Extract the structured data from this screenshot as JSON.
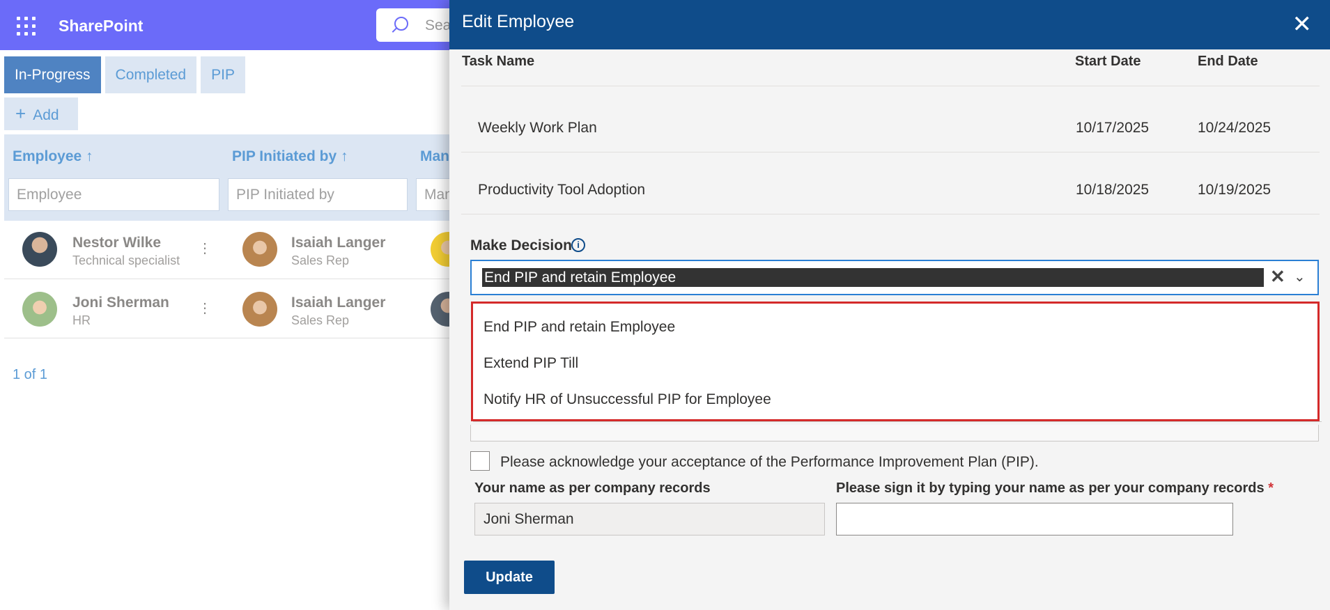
{
  "app": {
    "brand": "SharePoint",
    "search_placeholder": "Sea"
  },
  "tabs": [
    "In-Progress",
    "Completed",
    "PIP"
  ],
  "add_label": "Add",
  "grid": {
    "headers": [
      "Employee ↑",
      "PIP Initiated by ↑",
      "Man"
    ],
    "filters": [
      "Employee",
      "PIP Initiated by",
      "Man"
    ],
    "rows": [
      {
        "employee": "Nestor Wilke",
        "employee_role": "Technical specialist",
        "initiator": "Isaiah Langer",
        "initiator_role": "Sales Rep"
      },
      {
        "employee": "Joni Sherman",
        "employee_role": "HR",
        "initiator": "Isaiah Langer",
        "initiator_role": "Sales Rep"
      }
    ],
    "pager": "1 of 1"
  },
  "panel": {
    "title": "Edit Employee",
    "close_icon": "close-icon",
    "task_headers": [
      "Task Name",
      "Start Date",
      "End Date"
    ],
    "tasks": [
      {
        "name": "Weekly Work Plan",
        "start": "10/17/2025",
        "end": "10/24/2025"
      },
      {
        "name": "Productivity Tool Adoption",
        "start": "10/18/2025",
        "end": "10/19/2025"
      }
    ],
    "decision_label": "Make Decision",
    "decision_value": "End PIP and retain Employee",
    "decision_options": [
      "End PIP and retain Employee",
      "Extend PIP Till",
      "Notify HR of Unsuccessful PIP for Employee"
    ],
    "ack_label": "Please acknowledge your acceptance of the Performance Improvement Plan (PIP).",
    "name_label": "Your name as per company records",
    "name_value": "Joni Sherman",
    "sign_label": "Please sign it by typing your name as per your company records",
    "sign_required": "*",
    "update_label": "Update"
  },
  "colors": {
    "suite_bar": "#6b6bf9",
    "panel_header": "#0f4c8a",
    "highlight_border": "#d42a2a"
  }
}
